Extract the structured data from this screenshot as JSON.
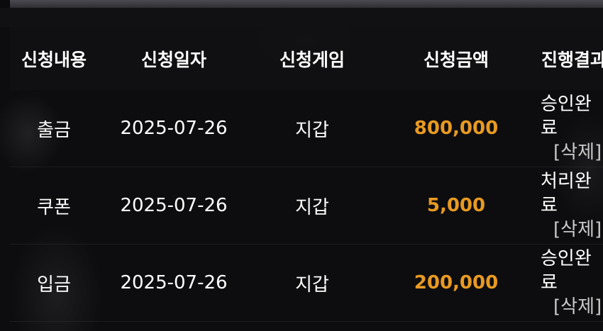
{
  "headers": [
    "신청내용",
    "신청일자",
    "신청게임",
    "신청금액",
    "진행결과"
  ],
  "rows": [
    {
      "type": "출금",
      "date": "2025-07-26",
      "game": "지갑",
      "amount": "800,000",
      "status": "승인완료",
      "delete": "[삭제]"
    },
    {
      "type": "쿠폰",
      "date": "2025-07-26",
      "game": "지갑",
      "amount": "5,000",
      "status": "처리완료",
      "delete": "[삭제]"
    },
    {
      "type": "입금",
      "date": "2025-07-26",
      "game": "지갑",
      "amount": "200,000",
      "status": "승인완료",
      "delete": "[삭제]"
    }
  ],
  "colors": {
    "amount": "#e89a21",
    "background": "#0b0b0d",
    "text": "#ffffff"
  }
}
